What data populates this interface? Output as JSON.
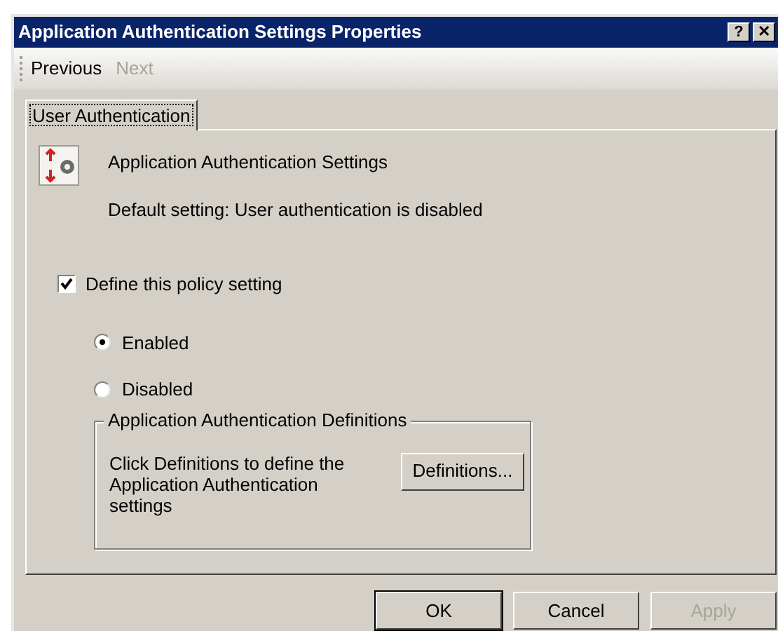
{
  "window": {
    "title": "Application Authentication Settings Properties",
    "help_button": "?",
    "close_button": "✕"
  },
  "toolbar": [
    {
      "label": "Previous",
      "disabled": false
    },
    {
      "label": "Next",
      "disabled": true
    }
  ],
  "tabs": [
    {
      "label": "User Authentication",
      "selected": true
    }
  ],
  "header": {
    "title": "Application Authentication Settings",
    "default_setting": "Default setting: User authentication is disabled"
  },
  "define_policy": {
    "label": "Define this policy setting",
    "checked": true
  },
  "options": [
    {
      "label": "Enabled",
      "selected": true
    },
    {
      "label": "Disabled",
      "selected": false
    }
  ],
  "group": {
    "title": "Application Authentication Definitions",
    "description": "Click Definitions to define the Application Authentication settings",
    "button": "Definitions..."
  },
  "buttons": [
    {
      "label": "OK",
      "default": true,
      "disabled": false
    },
    {
      "label": "Cancel",
      "default": false,
      "disabled": false
    },
    {
      "label": "Apply",
      "default": false,
      "disabled": true
    }
  ]
}
